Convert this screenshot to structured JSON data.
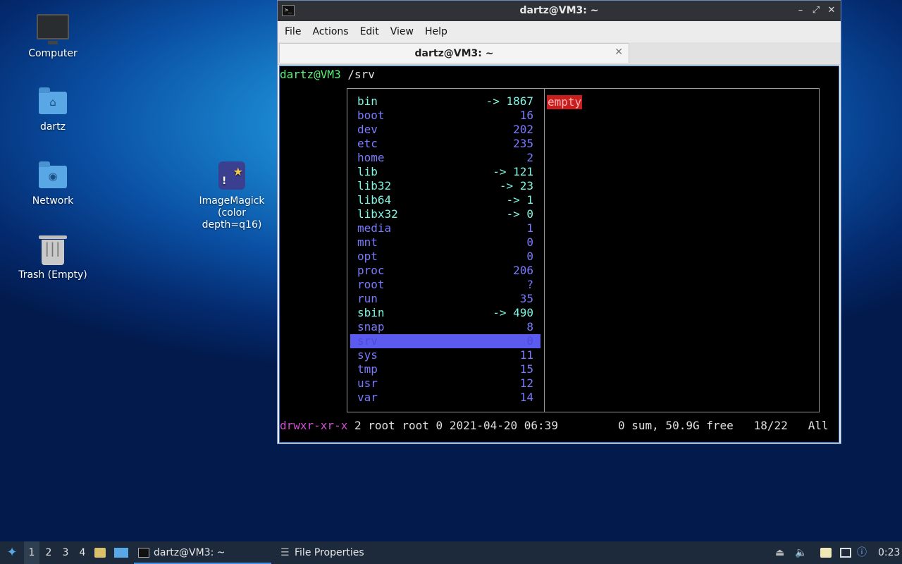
{
  "desktop": {
    "icons": [
      {
        "label": "Computer"
      },
      {
        "label": "dartz"
      },
      {
        "label": "Network"
      },
      {
        "label": "Trash (Empty)"
      },
      {
        "label": "ImageMagick (color depth=q16)"
      }
    ]
  },
  "window": {
    "title": "dartz@VM3: ~",
    "menu": [
      "File",
      "Actions",
      "Edit",
      "View",
      "Help"
    ],
    "tab_label": "dartz@VM3: ~",
    "prompt_user": "dartz@VM3",
    "prompt_path": " /srv",
    "listing": [
      {
        "name": "bin",
        "val": "-> 1867",
        "color": "cyan"
      },
      {
        "name": "boot",
        "val": "16",
        "color": "blue"
      },
      {
        "name": "dev",
        "val": "202",
        "color": "blue"
      },
      {
        "name": "etc",
        "val": "235",
        "color": "blue"
      },
      {
        "name": "home",
        "val": "2",
        "color": "blue"
      },
      {
        "name": "lib",
        "val": "-> 121",
        "color": "cyan"
      },
      {
        "name": "lib32",
        "val": "-> 23",
        "color": "cyan"
      },
      {
        "name": "lib64",
        "val": "-> 1",
        "color": "cyan"
      },
      {
        "name": "libx32",
        "val": "-> 0",
        "color": "cyan"
      },
      {
        "name": "media",
        "val": "1",
        "color": "blue"
      },
      {
        "name": "mnt",
        "val": "0",
        "color": "blue"
      },
      {
        "name": "opt",
        "val": "0",
        "color": "blue"
      },
      {
        "name": "proc",
        "val": "206",
        "color": "blue"
      },
      {
        "name": "root",
        "val": "?",
        "color": "blue"
      },
      {
        "name": "run",
        "val": "35",
        "color": "blue"
      },
      {
        "name": "sbin",
        "val": "-> 490",
        "color": "cyan"
      },
      {
        "name": "snap",
        "val": "8",
        "color": "blue"
      },
      {
        "name": "srv",
        "val": "0",
        "color": "blue",
        "selected": true
      },
      {
        "name": "sys",
        "val": "11",
        "color": "blue"
      },
      {
        "name": "tmp",
        "val": "15",
        "color": "blue"
      },
      {
        "name": "usr",
        "val": "12",
        "color": "blue"
      },
      {
        "name": "var",
        "val": "14",
        "color": "blue"
      }
    ],
    "preview_tag": "empty",
    "status": {
      "perms": "drwxr-xr-x",
      "info": " 2 root root 0 2021-04-20 06:39",
      "right": "0 sum, 50.9G free   18/22   All"
    }
  },
  "taskbar": {
    "workspaces": [
      "1",
      "2",
      "3",
      "4"
    ],
    "tasks": [
      "dartz@VM3: ~",
      "File Properties"
    ],
    "clock": "0:23"
  }
}
